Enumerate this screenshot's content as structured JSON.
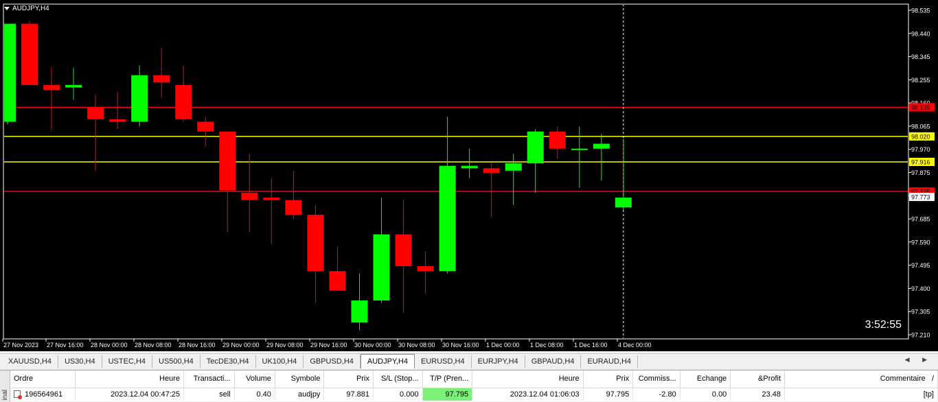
{
  "chart": {
    "title": "AUDJPY,H4",
    "countdown": "3:52:55",
    "colors": {
      "bull": "#00ff00",
      "bear": "#ff0000",
      "background": "#000000",
      "axis": "#ffffff",
      "tp_line": "#ff0000",
      "entry_line": "#ffff00"
    },
    "price_axis": [
      "98.535",
      "98.440",
      "98.345",
      "98.255",
      "98.160",
      "98.065",
      "97.970",
      "97.875",
      "97.780",
      "97.685",
      "97.590",
      "97.495",
      "97.400",
      "97.305",
      "97.210"
    ],
    "time_axis": [
      "27 Nov 2023",
      "27 Nov 16:00",
      "28 Nov 00:00",
      "28 Nov 08:00",
      "28 Nov 16:00",
      "29 Nov 00:00",
      "29 Nov 08:00",
      "29 Nov 16:00",
      "30 Nov 00:00",
      "30 Nov 08:00",
      "30 Nov 16:00",
      "1 Dec 00:00",
      "1 Dec 08:00",
      "1 Dec 16:00",
      "4 Dec 00:00"
    ],
    "price_labels": [
      {
        "text": "98.139",
        "price": 98.139,
        "bg": "#ff0000",
        "fg": "#000000"
      },
      {
        "text": "98.020",
        "price": 98.02,
        "bg": "#ffff00",
        "fg": "#000000"
      },
      {
        "text": "97.916",
        "price": 97.916,
        "bg": "#ffff00",
        "fg": "#000000"
      },
      {
        "text": "97.795",
        "price": 97.795,
        "bg": "#ff0000",
        "fg": "#000000"
      },
      {
        "text": "97.773",
        "price": 97.773,
        "bg": "#ffffff",
        "fg": "#000000"
      }
    ]
  },
  "chart_data": {
    "type": "candlestick",
    "symbol": "AUDJPY",
    "timeframe": "H4",
    "ylim": [
      97.2,
      98.56
    ],
    "hlines": [
      {
        "price": 98.139,
        "color": "#ff0000"
      },
      {
        "price": 98.02,
        "color": "#ffff00"
      },
      {
        "price": 97.916,
        "color": "#ffff00"
      },
      {
        "price": 97.795,
        "color": "#ff0000"
      }
    ],
    "candles": [
      {
        "o": 98.08,
        "h": 98.48,
        "l": 98.07,
        "c": 98.48
      },
      {
        "o": 98.48,
        "h": 98.49,
        "l": 98.24,
        "c": 98.23
      },
      {
        "o": 98.23,
        "h": 98.3,
        "l": 98.05,
        "c": 98.21
      },
      {
        "o": 98.22,
        "h": 98.3,
        "l": 98.17,
        "c": 98.23
      },
      {
        "o": 98.14,
        "h": 98.19,
        "l": 97.88,
        "c": 98.09
      },
      {
        "o": 98.09,
        "h": 98.2,
        "l": 98.05,
        "c": 98.08
      },
      {
        "o": 98.08,
        "h": 98.31,
        "l": 98.06,
        "c": 98.27
      },
      {
        "o": 98.27,
        "h": 98.38,
        "l": 98.18,
        "c": 98.24
      },
      {
        "o": 98.23,
        "h": 98.31,
        "l": 98.08,
        "c": 98.09
      },
      {
        "o": 98.08,
        "h": 98.1,
        "l": 97.98,
        "c": 98.04
      },
      {
        "o": 98.04,
        "h": 98.04,
        "l": 97.63,
        "c": 97.8
      },
      {
        "o": 97.79,
        "h": 97.95,
        "l": 97.63,
        "c": 97.76
      },
      {
        "o": 97.77,
        "h": 97.85,
        "l": 97.58,
        "c": 97.76
      },
      {
        "o": 97.76,
        "h": 97.88,
        "l": 97.68,
        "c": 97.7
      },
      {
        "o": 97.7,
        "h": 97.74,
        "l": 97.34,
        "c": 97.47
      },
      {
        "o": 97.47,
        "h": 97.57,
        "l": 97.4,
        "c": 97.39
      },
      {
        "o": 97.26,
        "h": 97.46,
        "l": 97.23,
        "c": 97.35
      },
      {
        "o": 97.35,
        "h": 97.77,
        "l": 97.34,
        "c": 97.62
      },
      {
        "o": 97.62,
        "h": 97.76,
        "l": 97.3,
        "c": 97.49
      },
      {
        "o": 97.49,
        "h": 97.55,
        "l": 97.38,
        "c": 97.47
      },
      {
        "o": 97.47,
        "h": 98.1,
        "l": 97.46,
        "c": 97.9
      },
      {
        "o": 97.89,
        "h": 97.97,
        "l": 97.85,
        "c": 97.9
      },
      {
        "o": 97.89,
        "h": 97.91,
        "l": 97.69,
        "c": 97.87
      },
      {
        "o": 97.88,
        "h": 97.95,
        "l": 97.74,
        "c": 97.91
      },
      {
        "o": 97.91,
        "h": 98.05,
        "l": 97.79,
        "c": 98.04
      },
      {
        "o": 98.04,
        "h": 98.06,
        "l": 97.93,
        "c": 97.97
      },
      {
        "o": 97.97,
        "h": 98.06,
        "l": 97.81,
        "c": 97.97
      },
      {
        "o": 97.97,
        "h": 98.03,
        "l": 97.84,
        "c": 97.99
      },
      {
        "o": 97.73,
        "h": 98.01,
        "l": 97.72,
        "c": 97.77
      }
    ]
  },
  "tabs": [
    "XAUUSD,H4",
    "US30,H4",
    "USTEC,H4",
    "US500,H4",
    "TecDE30,H4",
    "UK100,H4",
    "GBPUSD,H4",
    "AUDJPY,H4",
    "EURUSD,H4",
    "EURJPY,H4",
    "GBPAUD,H4",
    "EURAUD,H4"
  ],
  "tab_arrows": "◀ ▶",
  "terminal": {
    "side_label": "inal",
    "columns": [
      "Ordre",
      "Heure",
      "Transacti...",
      "Volume",
      "Symbole",
      "Prix",
      "S/L (Stop...",
      "T/P (Pren...",
      "Heure",
      "Prix",
      "Commiss...",
      "Echange",
      "&Profit",
      "Commentaire"
    ],
    "sort_marker": "/",
    "rows": [
      [
        "196564961",
        "2023.12.04 00:47:25",
        "sell",
        "0.40",
        "audjpy",
        "97.881",
        "0.000",
        "97.795",
        "2023.12.04 01:06:03",
        "97.795",
        "-2.80",
        "0.00",
        "23.48",
        "[tp]"
      ]
    ]
  }
}
